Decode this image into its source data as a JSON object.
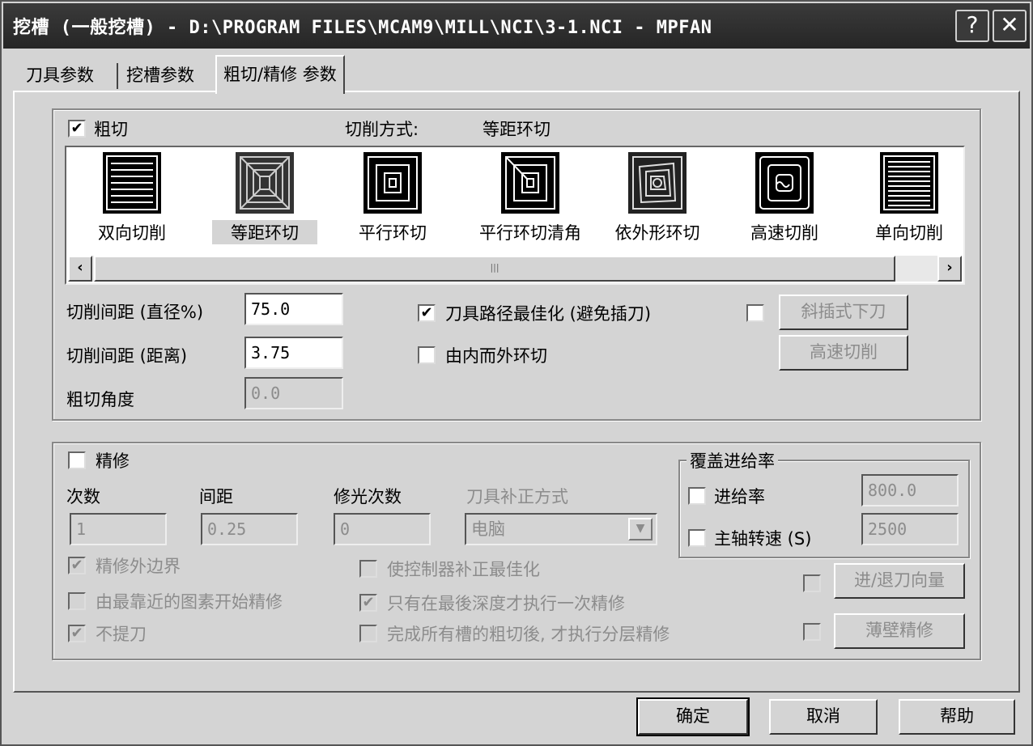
{
  "window": {
    "title": "挖槽 (一般挖槽) - D:\\PROGRAM FILES\\MCAM9\\MILL\\NCI\\3-1.NCI - MPFAN",
    "help_glyph": "?",
    "close_glyph": "✕"
  },
  "tabs": [
    {
      "label": "刀具参数"
    },
    {
      "label": "挖槽参数"
    },
    {
      "label": "粗切/精修 参数"
    }
  ],
  "rough": {
    "checkbox_label": "粗切",
    "checked": true,
    "method_label": "切削方式:",
    "method_value": "等距环切",
    "strategies": [
      {
        "label": "双向切削",
        "icon": "zigzag-icon"
      },
      {
        "label": "等距环切",
        "icon": "constant-overlap-spiral-icon",
        "selected": true
      },
      {
        "label": "平行环切",
        "icon": "parallel-spiral-icon"
      },
      {
        "label": "平行环切清角",
        "icon": "parallel-spiral-clean-corners-icon"
      },
      {
        "label": "依外形环切",
        "icon": "morph-spiral-icon"
      },
      {
        "label": "高速切削",
        "icon": "high-speed-icon"
      },
      {
        "label": "单向切削",
        "icon": "one-way-icon"
      }
    ],
    "scroll_thumb_grip": "|||",
    "stepover_pct_label": "切削间距 (直径%)",
    "stepover_pct_value": "75.0",
    "stepover_dist_label": "切削间距 (距离)",
    "stepover_dist_value": "3.75",
    "angle_label": "粗切角度",
    "angle_value": "0.0",
    "minimize_plunge_label": "刀具路径最佳化 (避免插刀)",
    "minimize_plunge_checked": true,
    "spiral_inside_out_label": "由内而外环切",
    "spiral_inside_out_checked": false,
    "ramp_entry_button": "斜插式下刀",
    "high_speed_button": "高速切削"
  },
  "finish": {
    "checkbox_label": "精修",
    "checked": false,
    "passes_label": "次数",
    "passes_value": "1",
    "spacing_label": "间距",
    "spacing_value": "0.25",
    "spring_passes_label": "修光次数",
    "spring_passes_value": "0",
    "comp_label": "刀具补正方式",
    "comp_value": "电脑",
    "outer_boundary_label": "精修外边界",
    "outer_boundary_checked": true,
    "start_closest_label": "由最靠近的图素开始精修",
    "start_closest_checked": false,
    "keep_tool_down_label": "不提刀",
    "keep_tool_down_checked": true,
    "optimize_control_label": "使控制器补正最佳化",
    "optimize_control_checked": false,
    "final_depth_only_label": "只有在最後深度才执行一次精修",
    "final_depth_only_checked": true,
    "after_all_rough_label": "完成所有槽的粗切後, 才执行分层精修",
    "after_all_rough_checked": false,
    "lead_in_out_button": "进/退刀向量",
    "thin_wall_button": "薄壁精修"
  },
  "override_feed": {
    "group_label": "覆盖进给率",
    "feed_label": "进给率",
    "feed_value": "800.0",
    "spindle_label": "主轴转速 (S)",
    "spindle_value": "2500"
  },
  "footer": {
    "ok": "确定",
    "cancel": "取消",
    "help": "帮助"
  }
}
